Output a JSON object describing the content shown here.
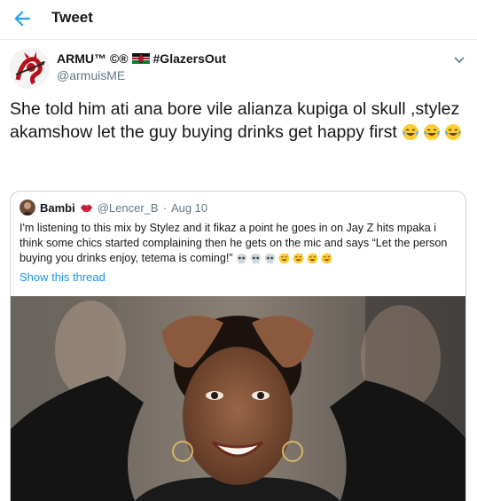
{
  "header": {
    "title": "Tweet",
    "back_icon": "back-arrow-icon",
    "accent": "#1da1f2"
  },
  "tweet": {
    "display_name": "ARMU™ ©®",
    "hashtag": "#GlazersOut",
    "handle": "@armuisME",
    "text": "She told him ati ana bore vile alianza kupiga ol skull ,stylez akamshow let the guy buying drinks get happy first",
    "emojis": [
      "face-with-tears-of-joy",
      "face-with-tears-of-joy",
      "face-with-tears-of-joy"
    ]
  },
  "quote": {
    "display_name": "Bambi",
    "handle": "@Lencer_B",
    "separator": "·",
    "date": "Aug 10",
    "text": "I'm listening to this mix by Stylez and it fikaz a point he goes in on Jay Z hits mpaka i think some chics started complaining then he gets on the mic and says “Let the person buying you drinks enjoy, tetema is coming!”",
    "emojis": [
      "skull",
      "skull",
      "skull",
      "grinning-sweat",
      "grinning-sweat",
      "grinning-sweat",
      "grinning-sweat"
    ],
    "show_thread": "Show this thread",
    "link_color": "#1b95e0"
  }
}
